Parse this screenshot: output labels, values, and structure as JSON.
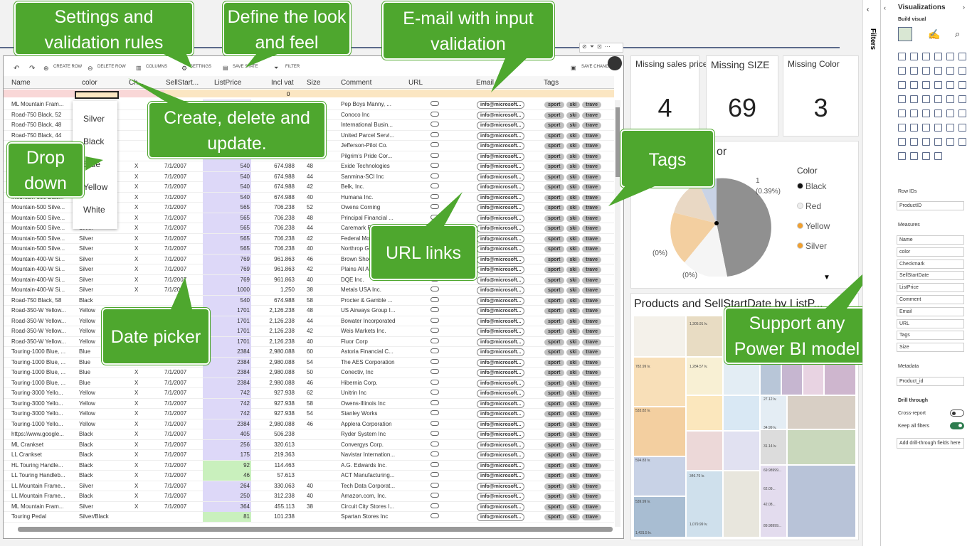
{
  "callouts": {
    "settings": "Settings and validation rules",
    "look": "Define the look and feel",
    "email": "E-mail with input validation",
    "crud": "Create, delete and update.",
    "dropdown": "Drop down",
    "tags": "Tags",
    "url": "URL links",
    "date": "Date picker",
    "support": "Support any Power BI model"
  },
  "toolbar": {
    "create": "CREATE ROW",
    "delete": "DELETE ROW",
    "columns": "COLUMNS",
    "settings": "SETTINGS",
    "save_state": "SAVE STATE",
    "filter": "FILTER",
    "save_changes": "SAVE CHANGES"
  },
  "headers": [
    "Name",
    "color",
    "Ch...",
    "SellStart...",
    "ListPrice",
    "Incl vat",
    "Size",
    "Comment",
    "URL",
    "Email",
    "Tags"
  ],
  "new_row_vat": "0",
  "dropdown": [
    "Silver",
    "Black",
    "Blue",
    "Yellow",
    "White"
  ],
  "rows": [
    [
      "ML Mountain Fram...",
      "",
      "",
      "",
      "",
      "",
      "",
      "Pep Boys Manny, ..."
    ],
    [
      "Road-750 Black, 52",
      "",
      "",
      "",
      "",
      "",
      "",
      "Conoco Inc"
    ],
    [
      "Road-750 Black, 48",
      "",
      "",
      "",
      "",
      "",
      "",
      "International Busin..."
    ],
    [
      "Road-750 Black, 44",
      "",
      "",
      "",
      "",
      "",
      "",
      "United Parcel Servi..."
    ],
    [
      "",
      "",
      "",
      "",
      "",
      "",
      "",
      "Jefferson-Pilot Co."
    ],
    [
      "",
      "",
      "",
      "",
      "",
      "",
      "",
      "Pilgrim's Pride Cor..."
    ],
    [
      "",
      "",
      "X",
      "7/1/2007",
      "540",
      "674.988",
      "48",
      "Exide Technologies"
    ],
    [
      "",
      "",
      "X",
      "7/1/2007",
      "540",
      "674.988",
      "44",
      "Sanmina-SCI Inc"
    ],
    [
      "",
      "",
      "X",
      "7/1/2007",
      "540",
      "674.988",
      "42",
      "Belk, Inc."
    ],
    [
      "Mountain-500 Blac...",
      "",
      "X",
      "7/1/2007",
      "540",
      "674.988",
      "40",
      "Humana Inc."
    ],
    [
      "Mountain-500 Silve...",
      "",
      "X",
      "7/1/2007",
      "565",
      "706.238",
      "52",
      "Owens Corning"
    ],
    [
      "Mountain-500 Silve...",
      "",
      "X",
      "7/1/2007",
      "565",
      "706.238",
      "48",
      "Principal Financial ..."
    ],
    [
      "Mountain-500 Silve...",
      "Silver",
      "X",
      "7/1/2007",
      "565",
      "706.238",
      "44",
      "Caremark R"
    ],
    [
      "Mountain-500 Silve...",
      "Silver",
      "X",
      "7/1/2007",
      "565",
      "706.238",
      "42",
      "Federal Mog"
    ],
    [
      "Mountain-500 Silve...",
      "Silver",
      "X",
      "7/1/2007",
      "565",
      "706.238",
      "40",
      "Northrop Gr"
    ],
    [
      "Mountain-400-W Si...",
      "Silver",
      "X",
      "7/1/2007",
      "769",
      "961.863",
      "46",
      "Brown Shoe"
    ],
    [
      "Mountain-400-W Si...",
      "Silver",
      "X",
      "7/1/2007",
      "769",
      "961.863",
      "42",
      "Plains All An"
    ],
    [
      "Mountain-400-W Si...",
      "Silver",
      "X",
      "7/1/2007",
      "769",
      "961.863",
      "40",
      "DQE Inc."
    ],
    [
      "Mountain-400-W Si...",
      "Silver",
      "X",
      "7/1/2007",
      "1000",
      "1,250",
      "38",
      "Metals USA Inc."
    ],
    [
      "Road-750 Black, 58",
      "Black",
      "",
      "",
      "540",
      "674.988",
      "58",
      "Procter & Gamble ..."
    ],
    [
      "Road-350-W Yellow...",
      "Yellow",
      "",
      "",
      "1701",
      "2,126.238",
      "48",
      "US Airways Group I..."
    ],
    [
      "Road-350-W Yellow...",
      "Yellow",
      "",
      "",
      "1701",
      "2,126.238",
      "44",
      "Bowater Incorporated"
    ],
    [
      "Road-350-W Yellow...",
      "Yellow",
      "",
      "",
      "1701",
      "2,126.238",
      "42",
      "Weis Markets Inc."
    ],
    [
      "Road-350-W Yellow...",
      "Yellow",
      "",
      "",
      "1701",
      "2,126.238",
      "40",
      "Fluor Corp"
    ],
    [
      "Touring-1000 Blue, ...",
      "Blue",
      "",
      "",
      "2384",
      "2,980.088",
      "60",
      "Astoria Financial C..."
    ],
    [
      "Touring-1000 Blue, ...",
      "Blue",
      "",
      "",
      "2384",
      "2,980.088",
      "54",
      "The AES Corporation"
    ],
    [
      "Touring-1000 Blue, ...",
      "Blue",
      "X",
      "7/1/2007",
      "2384",
      "2,980.088",
      "50",
      "Conectiv, Inc"
    ],
    [
      "Touring-1000 Blue, ...",
      "Blue",
      "X",
      "7/1/2007",
      "2384",
      "2,980.088",
      "46",
      "Hibernia Corp."
    ],
    [
      "Touring-3000 Yello...",
      "Yellow",
      "X",
      "7/1/2007",
      "742",
      "927.938",
      "62",
      "Unitrin Inc"
    ],
    [
      "Touring-3000 Yello...",
      "Yellow",
      "X",
      "7/1/2007",
      "742",
      "927.938",
      "58",
      "Owens-Illinois Inc"
    ],
    [
      "Touring-3000 Yello...",
      "Yellow",
      "X",
      "7/1/2007",
      "742",
      "927.938",
      "54",
      "Stanley Works"
    ],
    [
      "Touring-1000 Yello...",
      "Yellow",
      "X",
      "7/1/2007",
      "2384",
      "2,980.088",
      "46",
      "Applera Corporation"
    ],
    [
      "https://www.google...",
      "Black",
      "X",
      "7/1/2007",
      "405",
      "506.238",
      "",
      "Ryder System Inc"
    ],
    [
      "ML Crankset",
      "Black",
      "X",
      "7/1/2007",
      "256",
      "320.613",
      "",
      "Convergys Corp."
    ],
    [
      "LL Crankset",
      "Black",
      "X",
      "7/1/2007",
      "175",
      "219.363",
      "",
      "Navistar Internation..."
    ],
    [
      "HL Touring Handle...",
      "Black",
      "X",
      "7/1/2007",
      "92",
      "114.463",
      "",
      "A.G. Edwards Inc."
    ],
    [
      "LL Touring Handleb...",
      "Black",
      "X",
      "7/1/2007",
      "46",
      "57.613",
      "",
      "ACT Manufacturing..."
    ],
    [
      "LL Mountain Frame...",
      "Silver",
      "X",
      "7/1/2007",
      "264",
      "330.063",
      "40",
      "Tech Data Corporat..."
    ],
    [
      "LL Mountain Frame...",
      "Black",
      "X",
      "7/1/2007",
      "250",
      "312.238",
      "40",
      "Amazon.com, Inc."
    ],
    [
      "ML Mountain Fram...",
      "Silver",
      "X",
      "7/1/2007",
      "364",
      "455.113",
      "38",
      "Circuit City Stores I..."
    ],
    [
      "Touring Pedal",
      "Silver/Black",
      "",
      "",
      "81",
      "101.238",
      "",
      "Spartan Stores Inc"
    ]
  ],
  "email_value": "info@microsoft...",
  "tags": [
    "sport",
    "ski",
    "trave"
  ],
  "cards": [
    {
      "title": "Missing sales price",
      "value": "4"
    },
    {
      "title": "Missing SIZE",
      "value": "69"
    },
    {
      "title": "Missing Color",
      "value": "3"
    }
  ],
  "pie": {
    "title_fragment": "or",
    "legend_title": "Color",
    "legend": [
      {
        "name": "Black",
        "color": "#111111"
      },
      {
        "name": "Red",
        "color": "#eeeeee"
      },
      {
        "name": "Yellow",
        "color": "#f0a030"
      },
      {
        "name": "Silver",
        "color": "#f0a030"
      }
    ],
    "labels": {
      "one": "1",
      "one_pct": "(0.39%)",
      "zero1": "(0%)",
      "zero2": "(0%)"
    }
  },
  "treemap_title": "Products and SellStartDate by ListP...",
  "treemap_labels": [
    "1,305.91 lv.",
    "782.99 lv.",
    "1,284.57 lv.",
    "533.82 lv.",
    "594.83 lv.",
    "539.99 lv.",
    "1,431.5 lv.",
    "346.76 lv.",
    "1,079.99 lv.",
    "27.12 lv.",
    "34.99 lv.",
    "31.14 lv.",
    "69.98999...",
    "62.09...",
    "42.08...",
    "89.98999..."
  ],
  "pane": {
    "title": "Visualizations",
    "build": "Build visual",
    "filters": "Filters",
    "row_ids_label": "Row IDs",
    "row_id_field": "ProductID",
    "measures_label": "Measures",
    "measures": [
      "Name",
      "color",
      "Checkmark",
      "SellStartDate",
      "ListPrice",
      "Comment",
      "Email",
      "URL",
      "Tags",
      "Size"
    ],
    "metadata_label": "Metadata",
    "metadata_field": "Product_id",
    "drill_label": "Drill through",
    "cross_report": "Cross-report",
    "keep_filters": "Keep all filters",
    "add_drill": "Add drill-through fields here"
  }
}
